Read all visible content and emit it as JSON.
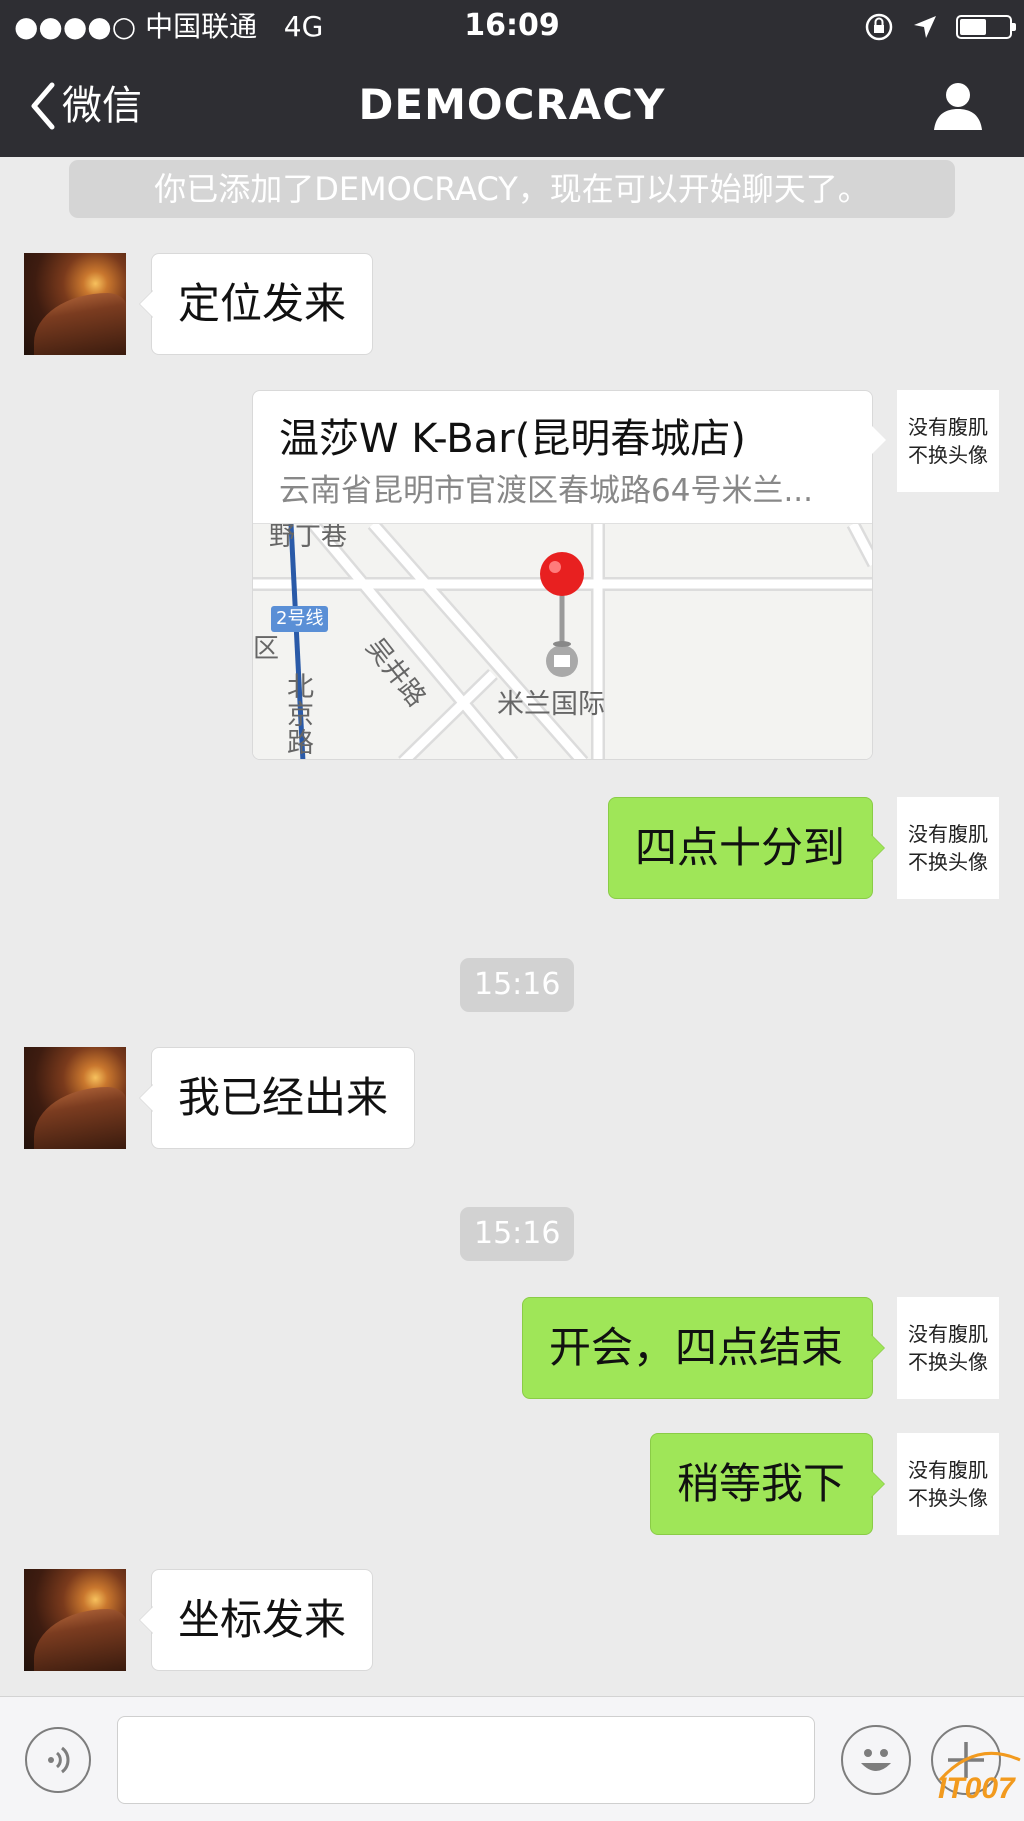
{
  "status_bar": {
    "signal_dots": "●●●●○",
    "carrier": "中国联通",
    "network": "4G",
    "time": "16:09",
    "battery_level": 0.55
  },
  "nav": {
    "back_label": "微信",
    "title": "DEMOCRACY"
  },
  "system_notice": "你已添加了DEMOCRACY，现在可以开始聊天了。",
  "self_avatar_text": [
    "没有腹肌",
    "不换头像"
  ],
  "messages": [
    {
      "side": "in",
      "text": "定位发来"
    },
    {
      "side": "out",
      "type": "location",
      "name": "温莎W K-Bar(昆明春城店)",
      "address": "云南省昆明市官渡区春城路64号米兰...",
      "map_labels": {
        "metro": "2号线",
        "road_a": "北京路",
        "road_b": "吴井路",
        "poi": "米兰国际",
        "top_cut": "野丁巷",
        "side_cut": "区"
      }
    },
    {
      "side": "out",
      "text": "四点十分到"
    },
    {
      "type": "time",
      "text": "15:16"
    },
    {
      "side": "in",
      "text": "我已经出来"
    },
    {
      "type": "time",
      "text": "15:16"
    },
    {
      "side": "out",
      "text": "开会，四点结束"
    },
    {
      "side": "out",
      "text": "稍等我下"
    },
    {
      "side": "in",
      "text": "坐标发来"
    }
  ],
  "input": {
    "placeholder": ""
  },
  "watermark": "IT007",
  "colors": {
    "nav_bg": "#2e2e33",
    "chat_bg": "#ebebeb",
    "outgoing_bubble": "#9fe658",
    "incoming_bubble": "#ffffff",
    "pin": "#e82020"
  }
}
